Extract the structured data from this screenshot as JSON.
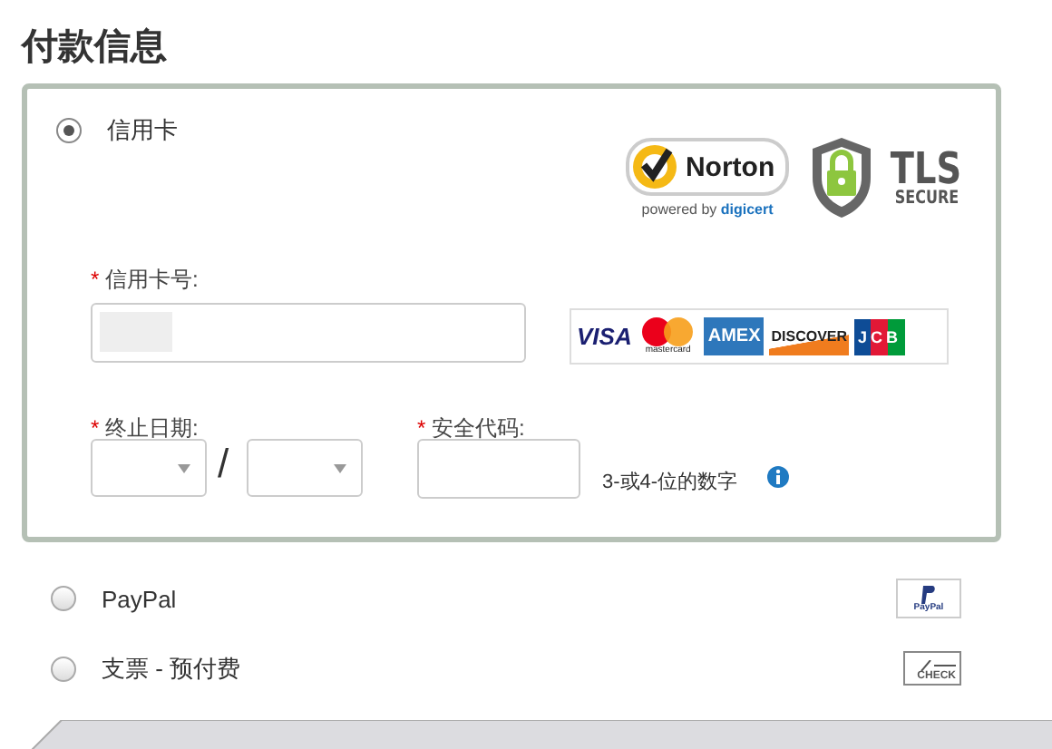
{
  "title": "付款信息",
  "methods": [
    {
      "label": "信用卡",
      "selected": true,
      "kind": "card"
    },
    {
      "label": "PayPal",
      "selected": false,
      "kind": "paypal",
      "badge": "PayPal"
    },
    {
      "label": "支票 - 预付费",
      "selected": false,
      "kind": "cheque",
      "badge": "CHECK"
    }
  ],
  "security_badges": {
    "norton": "Norton",
    "norton_sub": "powered by",
    "digicert": "digicert",
    "tls": "TLS",
    "tls_sub": "SECURE"
  },
  "card_brands": [
    "VISA",
    "mastercard",
    "AMEX",
    "DISCOVER",
    "JCB"
  ],
  "card_number": {
    "marker": "*",
    "label": "信用卡号:"
  },
  "expiry": {
    "marker": "*",
    "label": "终止日期:",
    "separator": "/"
  },
  "security_code": {
    "marker": "*",
    "label": "安全代码:",
    "hint": "3-或4-位的数字"
  }
}
